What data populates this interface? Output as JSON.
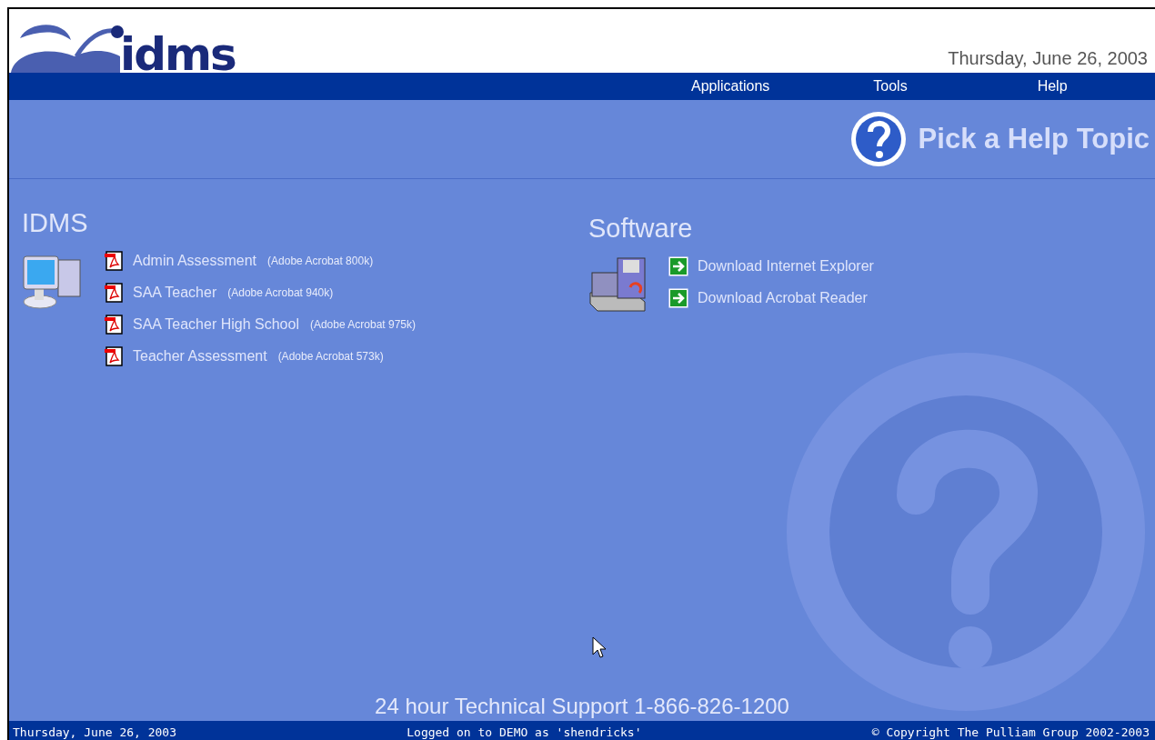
{
  "header": {
    "logo_text": "idms",
    "date": "Thursday, June 26, 2003"
  },
  "nav": [
    {
      "label": "Applications"
    },
    {
      "label": "Tools"
    },
    {
      "label": "Help"
    }
  ],
  "page_title": "Pick a Help Topic",
  "sections": [
    {
      "kind": "documents",
      "title": "IDMS",
      "items": [
        {
          "label": "Admin Assessment",
          "note": "(Adobe Acrobat 800k)"
        },
        {
          "label": "SAA Teacher",
          "note": "(Adobe Acrobat 940k)"
        },
        {
          "label": "SAA Teacher High School",
          "note": "(Adobe Acrobat 975k)"
        },
        {
          "label": "Teacher Assessment",
          "note": "(Adobe Acrobat 573k)"
        }
      ]
    },
    {
      "kind": "software",
      "title": "Software",
      "items": [
        {
          "label": "Download Internet Explorer"
        },
        {
          "label": "Download Acrobat Reader"
        }
      ]
    }
  ],
  "support": "24 hour Technical Support 1-866-826-1200",
  "status_bar": {
    "date": "Thursday, June 26, 2003",
    "login": "Logged on to DEMO as 'shendricks'",
    "copyright": "© Copyright The Pulliam Group 2002-2003"
  }
}
